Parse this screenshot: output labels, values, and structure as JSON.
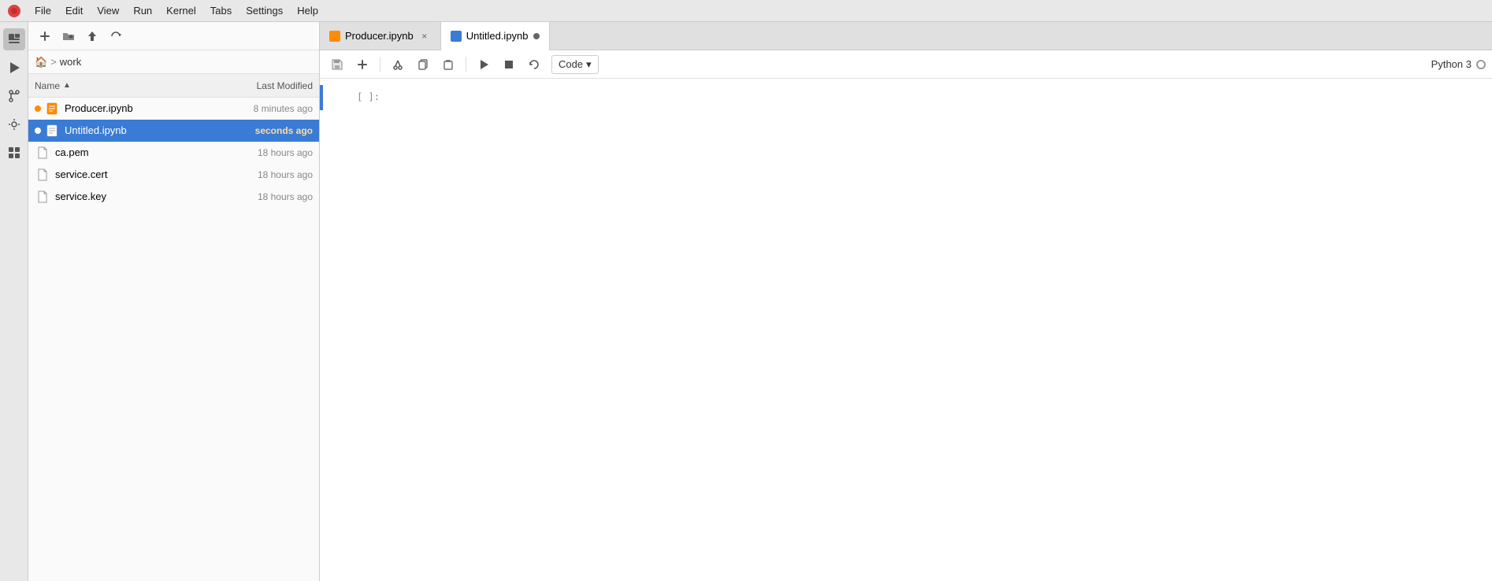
{
  "menubar": {
    "logo": "🔴",
    "items": [
      "File",
      "Edit",
      "View",
      "Run",
      "Kernel",
      "Tabs",
      "Settings",
      "Help"
    ]
  },
  "icon_sidebar": {
    "icons": [
      {
        "name": "folder-icon",
        "glyph": "📁"
      },
      {
        "name": "run-icon",
        "glyph": "▶"
      },
      {
        "name": "git-icon",
        "glyph": "⑂"
      },
      {
        "name": "tools-icon",
        "glyph": "🔧"
      },
      {
        "name": "extension-icon",
        "glyph": "⬛"
      }
    ]
  },
  "file_browser": {
    "toolbar": {
      "new_folder_btn": "+",
      "upload_btn": "⬆",
      "refresh_btn": "↻"
    },
    "breadcrumb": {
      "home_label": "🏠",
      "separator": ">",
      "current": "work"
    },
    "header": {
      "name_label": "Name",
      "sort_icon": "▲",
      "modified_label": "Last Modified"
    },
    "files": [
      {
        "name": "Producer.ipynb",
        "type": "notebook",
        "dot_color": "orange",
        "modified": "8 minutes ago",
        "selected": false
      },
      {
        "name": "Untitled.ipynb",
        "type": "notebook",
        "dot_color": "blue",
        "modified": "seconds ago",
        "selected": true
      },
      {
        "name": "ca.pem",
        "type": "file",
        "modified": "18 hours ago",
        "selected": false
      },
      {
        "name": "service.cert",
        "type": "file",
        "modified": "18 hours ago",
        "selected": false
      },
      {
        "name": "service.key",
        "type": "file",
        "modified": "18 hours ago",
        "selected": false
      }
    ]
  },
  "notebook": {
    "tabs": [
      {
        "label": "Producer.ipynb",
        "icon_color": "orange",
        "active": false,
        "has_close": true,
        "unsaved": false
      },
      {
        "label": "Untitled.ipynb",
        "icon_color": "blue",
        "active": true,
        "has_close": false,
        "unsaved": true
      }
    ],
    "toolbar": {
      "save_icon": "💾",
      "add_icon": "+",
      "cut_icon": "✂",
      "copy_icon": "⧉",
      "paste_icon": "📋",
      "run_icon": "▶",
      "stop_icon": "■",
      "restart_icon": "↺",
      "cell_type": "Code",
      "cell_type_arrow": "▾"
    },
    "kernel": {
      "label": "Python 3",
      "status": "idle"
    },
    "cells": [
      {
        "prompt": "[ ]:",
        "content": ""
      }
    ]
  }
}
